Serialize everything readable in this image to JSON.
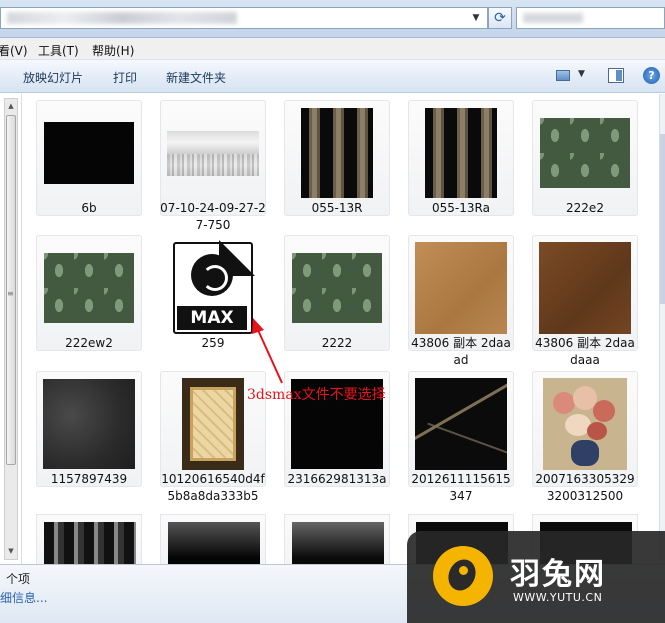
{
  "menu": {
    "view": "看(V)",
    "tools": "工具(T)",
    "help": "帮助(H)"
  },
  "toolbar": {
    "slideshow": "放映幻灯片",
    "print": "打印",
    "new_folder": "新建文件夹"
  },
  "files": [
    {
      "name": "6b",
      "kind": "black"
    },
    {
      "name": "07-10-24-09-27-27-750",
      "kind": "fog"
    },
    {
      "name": "055-13R",
      "kind": "stripe"
    },
    {
      "name": "055-13Ra",
      "kind": "stripe"
    },
    {
      "name": "222e2",
      "kind": "damask"
    },
    {
      "name": "222ew2",
      "kind": "damask"
    },
    {
      "name": "259",
      "kind": "max"
    },
    {
      "name": "2222",
      "kind": "damask"
    },
    {
      "name": "43806 副本 2daaad",
      "kind": "wood-light"
    },
    {
      "name": "43806 副本 2daadaaa",
      "kind": "wood-dark"
    },
    {
      "name": "1157897439",
      "kind": "concrete"
    },
    {
      "name": "10120616540d4f5b8a8da333b5",
      "kind": "quilt"
    },
    {
      "name": "231662981313a",
      "kind": "black"
    },
    {
      "name": "2012611115615347",
      "kind": "marble"
    },
    {
      "name": "20071633053293200312500",
      "kind": "flowers"
    }
  ],
  "max_icon_text": "MAX",
  "annotation": "3dsmax文件不要选择",
  "status": {
    "count": "个项",
    "details": "细信息..."
  },
  "watermark": {
    "name": "羽兔网",
    "url": "WWW.YUTU.CN"
  },
  "colors": {
    "annotation": "#e5151b",
    "watermark_logo": "#f5b400"
  }
}
